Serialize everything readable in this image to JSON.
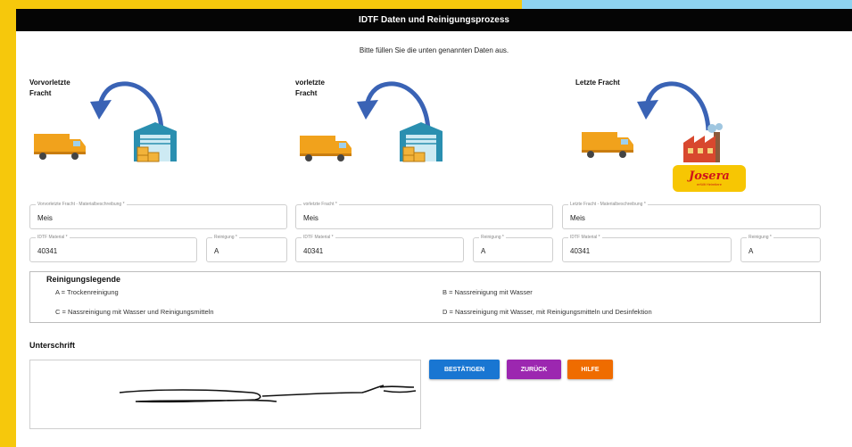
{
  "header": {
    "title": "IDTF Daten und Reinigungsprozess"
  },
  "intro": "Bitte füllen Sie die unten genannten Daten aus.",
  "sections": [
    {
      "title_line1": "Vorvorletzte",
      "title_line2": "Fracht",
      "material_label": "Vorvorletzte Fracht - Materialbeschreibung *",
      "material_value": "Meis",
      "idtf_label": "IDTF Material *",
      "idtf_value": "40341",
      "cleaning_label": "Reinigung *",
      "cleaning_value": "A"
    },
    {
      "title_line1": "vorletzte",
      "title_line2": "Fracht",
      "material_label": "vorletzte Fracht *",
      "material_value": "Meis",
      "idtf_label": "IDTF Material *",
      "idtf_value": "40341",
      "cleaning_label": "Reinigung *",
      "cleaning_value": "A"
    },
    {
      "title_line1": "Letzte Fracht",
      "title_line2": "",
      "material_label": "Letzte Fracht - Materialbeschreibung *",
      "material_value": "Meis",
      "idtf_label": "IDTF Material *",
      "idtf_value": "40341",
      "cleaning_label": "Reinigung *",
      "cleaning_value": "A"
    }
  ],
  "brand": {
    "name": "Josera",
    "tagline": "erfüllt Heimtiere"
  },
  "legend": {
    "title": "Reinigungslegende",
    "a": "A = Trockenreinigung",
    "b": "B = Nassreinigung mit Wasser",
    "c": "C = Nassreinigung mit Wasser und Reinigungsmitteln",
    "d": "D = Nassreinigung mit Wasser, mit Reinigungsmitteln und Desinfektion"
  },
  "signature": {
    "label": "Unterschrift"
  },
  "buttons": {
    "confirm": "BESTÄTIGEN",
    "back": "ZURÜCK",
    "help": "HILFE"
  },
  "colors": {
    "header_bg": "#050505",
    "frame": "#f6c80c",
    "confirm": "#1976d2",
    "back": "#9c27b0",
    "help": "#ef6c00",
    "arrow": "#3a63b5"
  }
}
